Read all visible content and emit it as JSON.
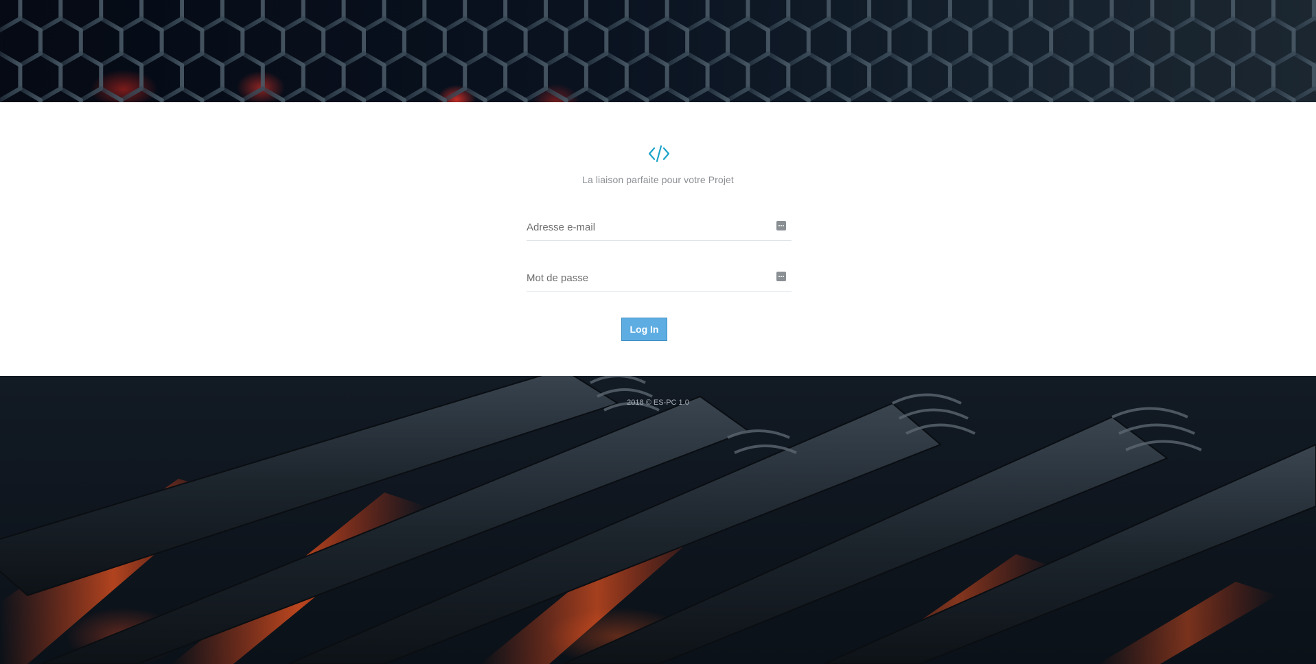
{
  "brand": {
    "logo_icon": "code-brackets-icon",
    "tagline": "La liaison parfaite pour votre Projet",
    "accent_color": "#1aa3c8"
  },
  "login_form": {
    "email_placeholder": "Adresse e-mail",
    "password_placeholder": "Mot de passe",
    "field_icon": "password-manager-icon",
    "submit_label": "Log In",
    "button_color": "#5dade2"
  },
  "footer": {
    "text": "2018 © ES-PC 1.0"
  }
}
